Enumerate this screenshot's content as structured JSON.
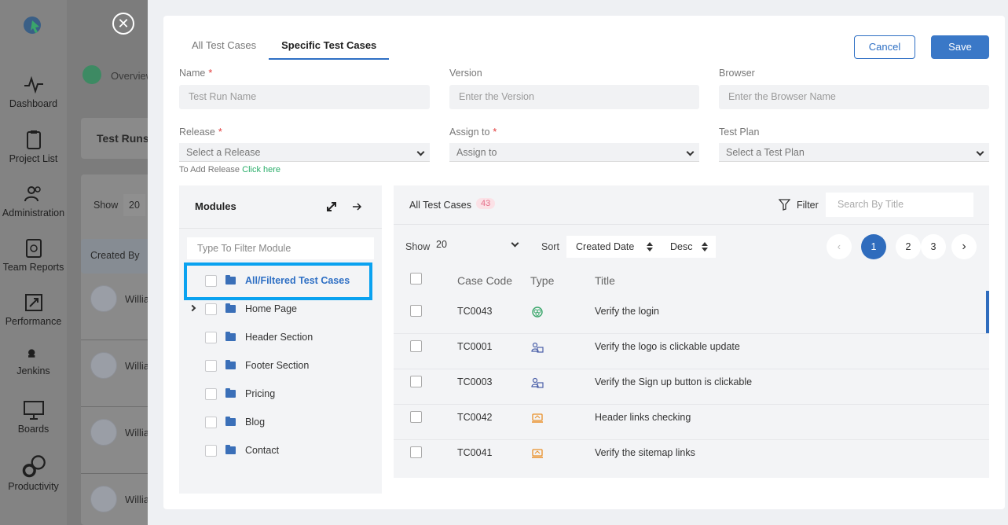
{
  "sidebar": {
    "items": [
      {
        "label": "Dashboard",
        "icon": "pulse-icon"
      },
      {
        "label": "Project List",
        "icon": "clipboard-icon"
      },
      {
        "label": "Administration",
        "icon": "users-icon"
      },
      {
        "label": "Team Reports",
        "icon": "report-icon"
      },
      {
        "label": "Performance",
        "icon": "rocket-icon"
      },
      {
        "label": "Jenkins",
        "icon": "jenkins-icon"
      },
      {
        "label": "Boards",
        "icon": "board-icon"
      },
      {
        "label": "Productivity",
        "icon": "gears-icon"
      }
    ]
  },
  "background": {
    "breadcrumb": "Overview",
    "page_title": "Test Runs",
    "show_label": "Show",
    "show_value": "20",
    "created_by": "Created By",
    "users": [
      "Willia",
      "Willia",
      "Willia",
      "Willia"
    ]
  },
  "tabs": [
    "All Test Cases",
    "Specific Test Cases"
  ],
  "buttons": {
    "cancel": "Cancel",
    "save": "Save"
  },
  "form": {
    "name_label": "Name",
    "name_placeholder": "Test Run Name",
    "version_label": "Version",
    "version_placeholder": "Enter the Version",
    "browser_label": "Browser",
    "browser_placeholder": "Enter the Browser Name",
    "release_label": "Release",
    "release_value": "Select a Release",
    "assign_label": "Assign to",
    "assign_value": "Assign to",
    "plan_label": "Test Plan",
    "plan_value": "Select a Test Plan",
    "hint_text": "To Add Release",
    "hint_link": "Click here",
    "required_mark": "*"
  },
  "modules": {
    "title": "Modules",
    "filter_placeholder": "Type To Filter Module",
    "items": [
      {
        "label": "All/Filtered Test Cases",
        "active": true
      },
      {
        "label": "Home Page"
      },
      {
        "label": "Header Section"
      },
      {
        "label": "Footer Section"
      },
      {
        "label": "Pricing"
      },
      {
        "label": "Blog"
      },
      {
        "label": "Contact"
      }
    ]
  },
  "cases": {
    "title": "All Test Cases",
    "count": "43",
    "filter_label": "Filter",
    "search_placeholder": "Search By Title",
    "show_label": "Show",
    "show_value": "20",
    "sort_label": "Sort",
    "sort_value": "Created Date",
    "order_value": "Desc",
    "pages": [
      "1",
      "2",
      "3"
    ],
    "prev": "‹",
    "next": "›",
    "columns": [
      "Case Code",
      "Type",
      "Title"
    ],
    "rows": [
      {
        "code": "TC0043",
        "type": "functional-icon",
        "title": "Verify the login"
      },
      {
        "code": "TC0001",
        "type": "usability-icon",
        "title": "Verify the logo is clickable update"
      },
      {
        "code": "TC0003",
        "type": "usability-icon",
        "title": "Verify the Sign up button is clickable"
      },
      {
        "code": "TC0042",
        "type": "ui-icon",
        "title": "Header links checking"
      },
      {
        "code": "TC0041",
        "type": "ui-icon",
        "title": "Verify the sitemap links"
      }
    ]
  },
  "colors": {
    "accent": "#2e6fc4",
    "highlight": "#0aa2f0",
    "link_green": "#2cae6b"
  }
}
